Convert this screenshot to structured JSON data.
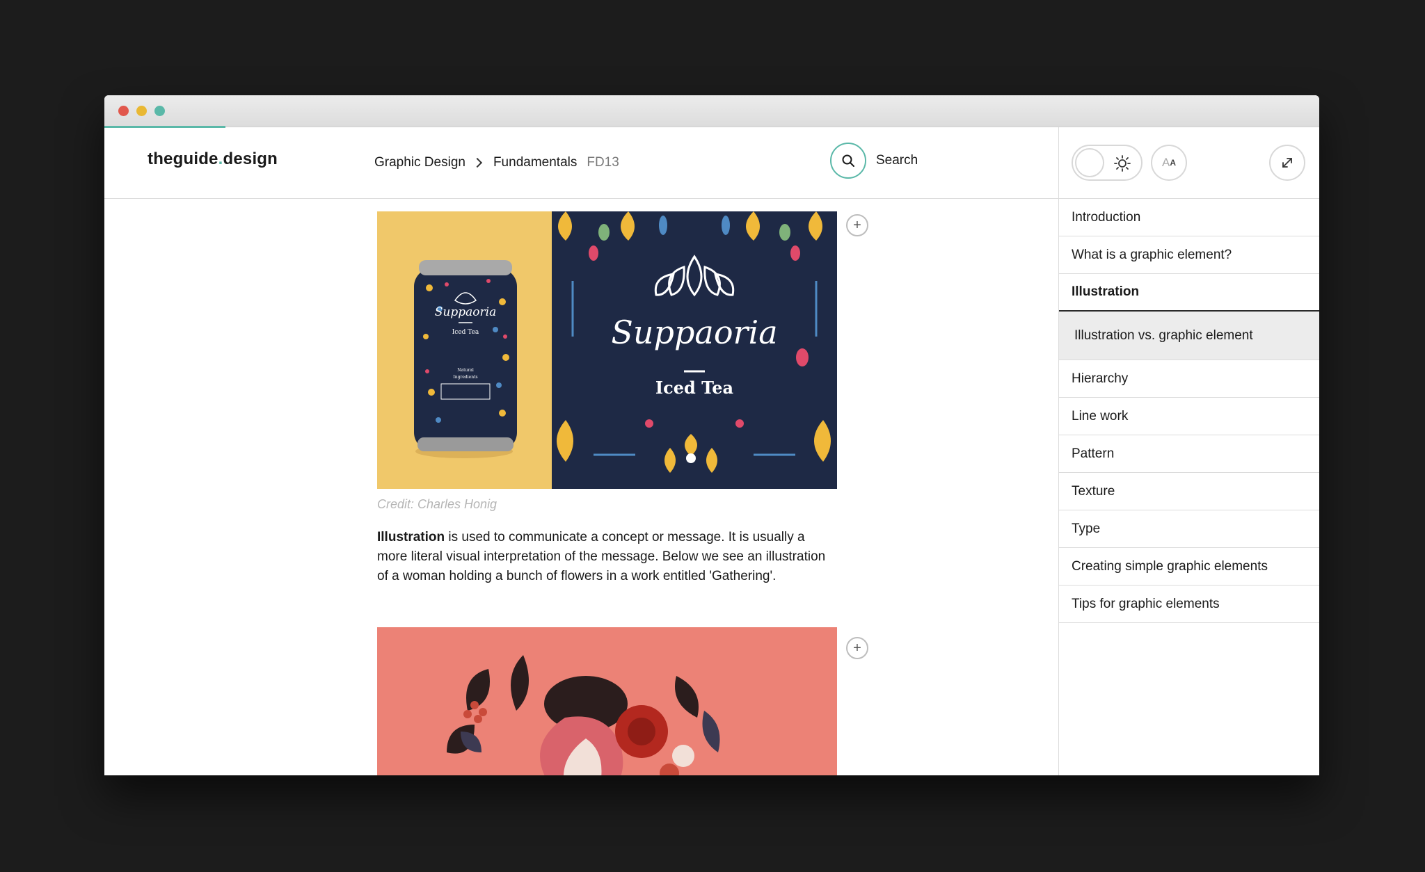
{
  "window": {
    "controls": [
      "close",
      "minimize",
      "maximize"
    ]
  },
  "header": {
    "logo_left": "theguide",
    "logo_dot": ".",
    "logo_right": "design",
    "breadcrumb": [
      "Graphic Design",
      "Fundamentals"
    ],
    "page_code": "FD13",
    "search_label": "Search"
  },
  "toolbar": {
    "theme_toggle_icon": "sun-icon",
    "font_size_label_big": "A",
    "font_size_label_small": "A",
    "expand_icon": "expand-icon"
  },
  "toc": {
    "items": [
      {
        "label": "Introduction",
        "state": "normal"
      },
      {
        "label": "What is a graphic element?",
        "state": "normal"
      },
      {
        "label": "Illustration",
        "state": "active"
      },
      {
        "label": "Illustration vs. graphic element",
        "state": "sub-highlighted"
      },
      {
        "label": "Hierarchy",
        "state": "normal"
      },
      {
        "label": "Line work",
        "state": "normal"
      },
      {
        "label": "Pattern",
        "state": "normal"
      },
      {
        "label": "Texture",
        "state": "normal"
      },
      {
        "label": "Type",
        "state": "normal"
      },
      {
        "label": "Creating simple graphic elements",
        "state": "normal"
      },
      {
        "label": "Tips for graphic elements",
        "state": "normal"
      }
    ]
  },
  "content": {
    "figure1": {
      "can_brand": "Suppaoria",
      "can_sub": "Iced Tea",
      "can_label_1": "Natural",
      "can_label_2": "Ingredients",
      "brand": "Suppaoria",
      "sub": "Iced Tea"
    },
    "caption": "Credit: Charles Honig",
    "paragraph_bold": "Illustration",
    "paragraph_rest": " is used to communicate a concept or message. It is usually a more literal visual interpretation of the message. Below we see an illustration of a woman holding a bunch of flowers in a work entitled 'Gathering'.",
    "add_button_symbol": "+"
  },
  "colors": {
    "accent": "#5ab8a8",
    "background": "#1c1c1c",
    "can_bg": "#f0c86a",
    "pattern_bg": "#1e2945",
    "figure2_bg": "#ec8276"
  }
}
